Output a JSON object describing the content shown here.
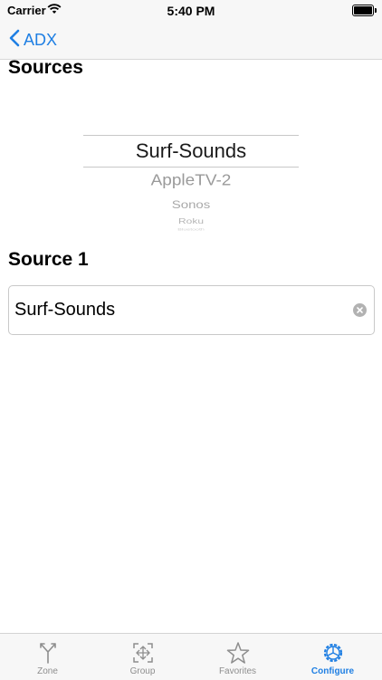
{
  "status_bar": {
    "carrier": "Carrier",
    "time": "5:40 PM"
  },
  "nav": {
    "back_label": "ADX"
  },
  "sources": {
    "title": "Sources",
    "picker_items": [
      "Surf-Sounds",
      "AppleTV-2",
      "Sonos",
      "Roku",
      "Bluetooth"
    ],
    "selected": "Surf-Sounds"
  },
  "source1": {
    "title": "Source 1",
    "field_value": "Surf-Sounds"
  },
  "tab_bar": {
    "tabs": [
      {
        "label": "Zone",
        "icon": "zone-icon"
      },
      {
        "label": "Group",
        "icon": "group-icon"
      },
      {
        "label": "Favorites",
        "icon": "star-icon"
      },
      {
        "label": "Configure",
        "icon": "configure-icon",
        "active": true
      }
    ]
  },
  "colors": {
    "accent": "#1f7fe3",
    "inactive_tab": "#8e8e8e",
    "bar_bg": "#f7f7f7"
  }
}
